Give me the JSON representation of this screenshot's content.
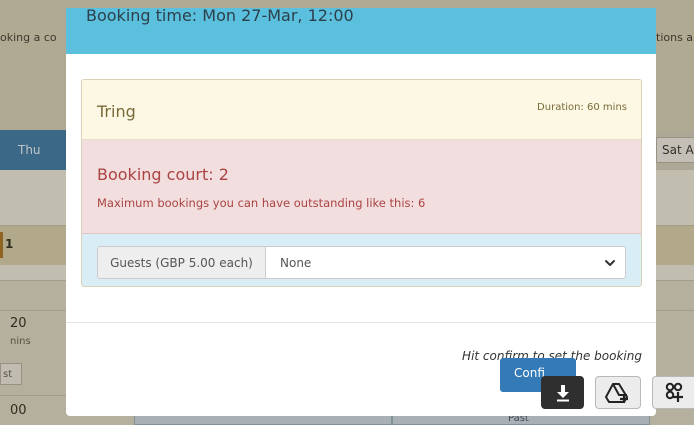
{
  "background": {
    "left_text": "oking a co",
    "right_text": "tions a",
    "day_thu": "Thu",
    "day_sat": "Sat A",
    "row_number": "1",
    "time_1": "20",
    "time_1_unit": "nins",
    "past_label_short": "st",
    "time_2": "00",
    "past_label": "Past"
  },
  "modal": {
    "title": "Booking time: Mon 27-Mar, 12:00",
    "activity_name": "Tring",
    "duration": "Duration: 60 mins",
    "court_title": "Booking court: 2",
    "max_bookings_text": "Maximum bookings you can have outstanding like this: 6",
    "guests_label": "Guests (GBP 5.00 each)",
    "guests_value": "None",
    "footer_hint": "Hit confirm to set the booking",
    "confirm_label": "Confi"
  },
  "toolbar": {
    "download_icon": "download-icon",
    "drive_icon": "google-drive-add-icon",
    "extension_icon": "extension-add-icon"
  }
}
